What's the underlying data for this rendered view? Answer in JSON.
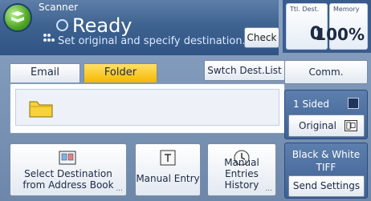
{
  "app": {
    "name": "Scanner",
    "status": "Ready",
    "message": "Set original and specify destination."
  },
  "header": {
    "check_label": "Check"
  },
  "counters": {
    "ttl_dest_label": "Ttl. Dest.",
    "ttl_dest_value": "0",
    "memory_label": "Memory",
    "memory_value": "100%"
  },
  "tabs": [
    {
      "label": "Email"
    },
    {
      "label": "Folder"
    }
  ],
  "swtch_dest_list": "Swtch Dest.List",
  "comm_status": "Comm. Status/Print",
  "sided": "1 Sided",
  "original": "Original",
  "send_settings": {
    "mode_line1": "Black & White",
    "mode_line2": "TIFF",
    "label": "Send Settings"
  },
  "bottom": [
    {
      "line1": "Select Destination",
      "line2": "from Address Book"
    },
    {
      "line1": "Manual Entry"
    },
    {
      "line1": "Manual Entries",
      "line2": "History"
    }
  ],
  "ellipsis": "..."
}
